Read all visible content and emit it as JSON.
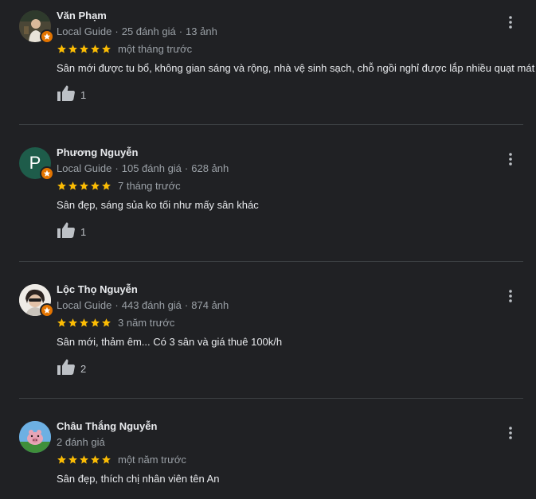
{
  "reviews": [
    {
      "name": "Văn Phạm",
      "guide_label": "Local Guide",
      "review_count": "25 đánh giá",
      "photo_count": "13 ảnh",
      "when": "một tháng trước",
      "text": "Sân mới được tu bổ, không gian sáng và rộng, nhà vệ sinh sạch, chỗ ngồi nghỉ được lắp nhiều quạt mát",
      "likes": "1",
      "stars": 5
    },
    {
      "name": "Phương Nguyễn",
      "avatar_letter": "P",
      "avatar_color": "#1e5c4a",
      "guide_label": "Local Guide",
      "review_count": "105 đánh giá",
      "photo_count": "628 ảnh",
      "when": "7 tháng trước",
      "text": "Sân đẹp, sáng sủa ko tối như mấy sân khác",
      "likes": "1",
      "stars": 5
    },
    {
      "name": "Lộc Thọ Nguyễn",
      "guide_label": "Local Guide",
      "review_count": "443 đánh giá",
      "photo_count": "874 ảnh",
      "when": "3 năm trước",
      "text": "Sân mới, thảm êm... Có 3 sân và giá thuê 100k/h",
      "likes": "2",
      "stars": 5
    },
    {
      "name": "Châu Thắng Nguyễn",
      "review_count": "2 đánh giá",
      "when": "một năm trước",
      "text": "Sân đẹp, thích chị nhân viên tên An",
      "stars": 5
    }
  ],
  "colors": {
    "background": "#202124",
    "star": "#fbbc04",
    "guide_badge": "#e37400",
    "divider": "#3c4043"
  },
  "icons": {
    "star": "star-icon",
    "like": "thumbs-up-icon",
    "more": "more-vert-icon",
    "badge": "local-guide-badge-icon"
  }
}
